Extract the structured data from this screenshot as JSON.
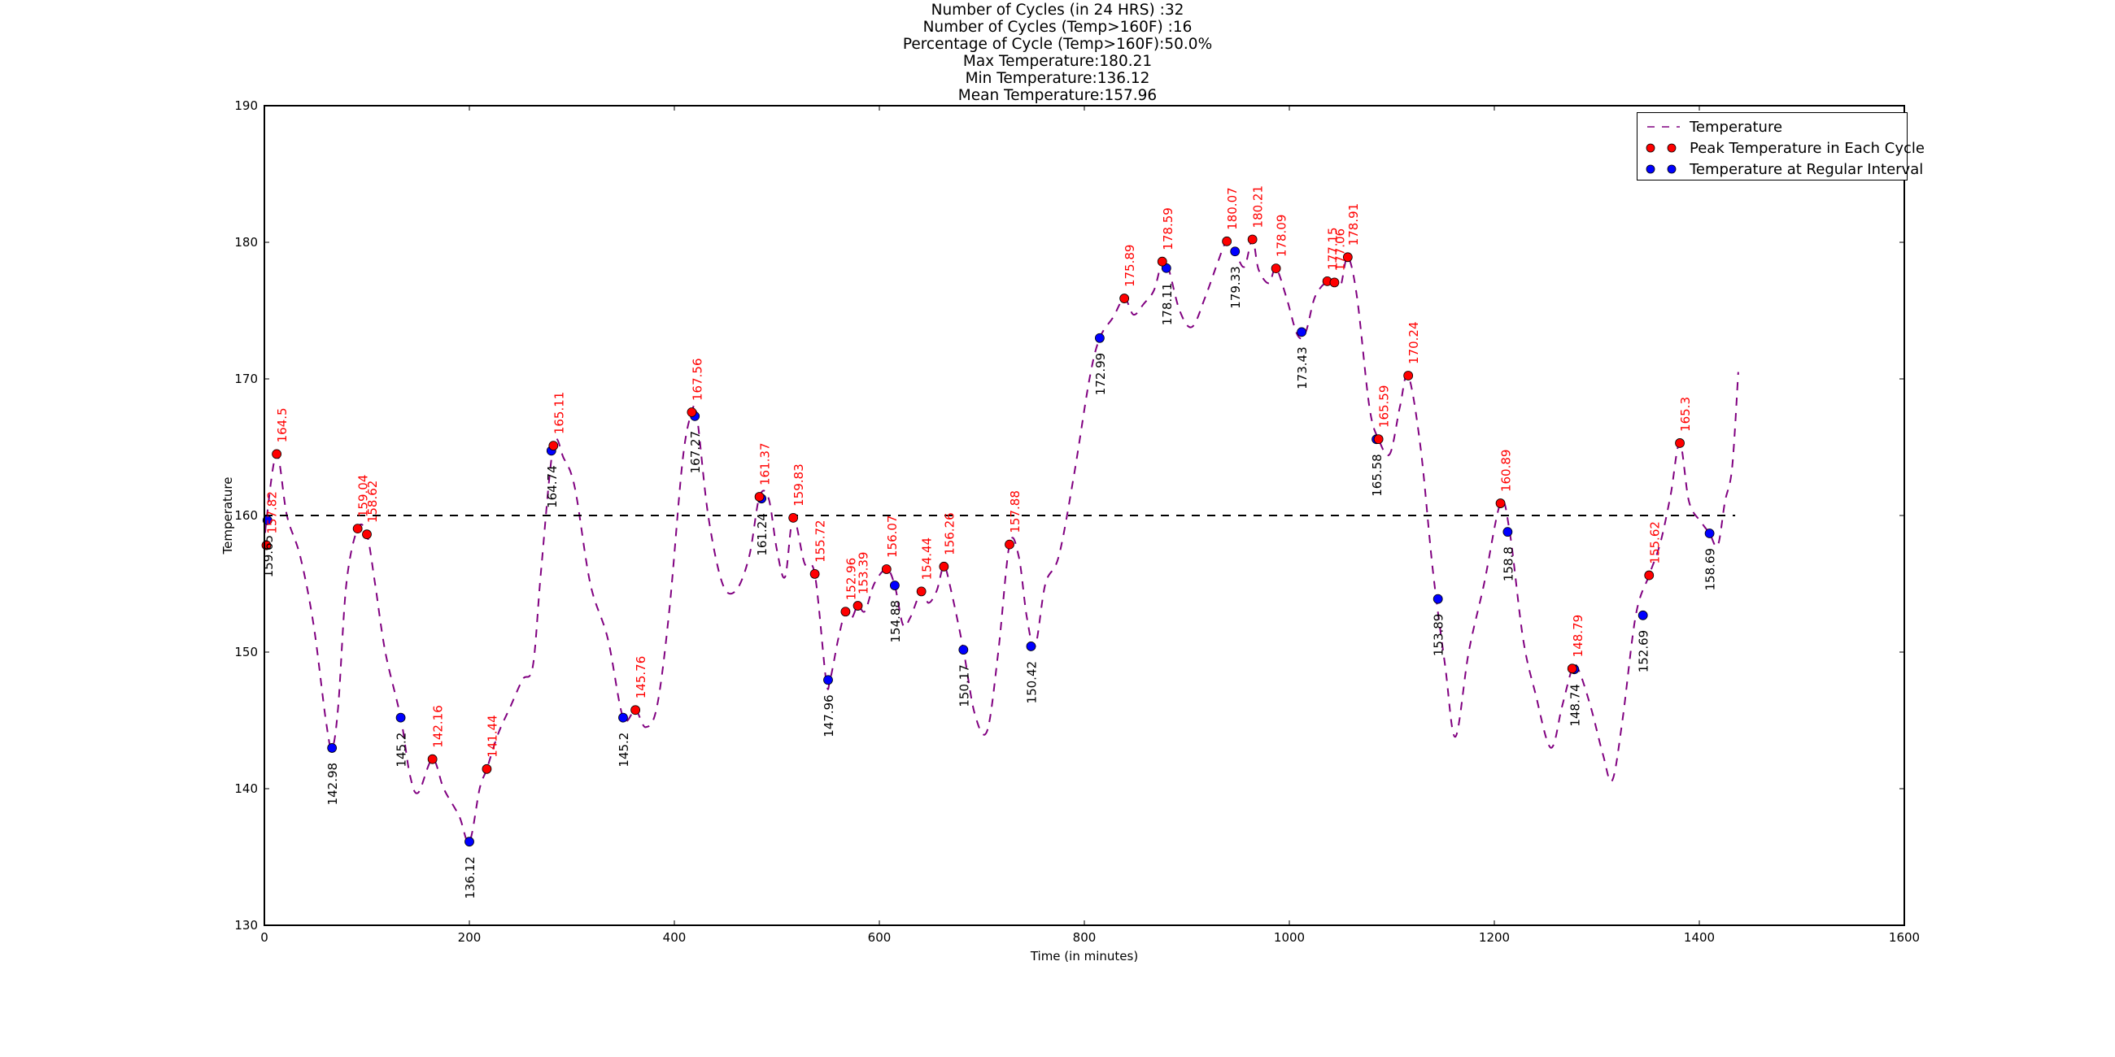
{
  "title_lines": [
    "Number of Cycles (in 24 HRS) :32",
    "Number of Cycles (Temp>160F) :16",
    "Percentage of Cycle (Temp>160F):50.0%",
    "Max Temperature:180.21",
    "Min Temperature:136.12",
    "Mean Temperature:157.96"
  ],
  "legend": {
    "placement": "top-right",
    "items": [
      {
        "label": "Temperature",
        "kind": "dashed-line",
        "color": "#800080"
      },
      {
        "label": "Peak Temperature in Each Cycle",
        "kind": "marker",
        "color": "#ff0000"
      },
      {
        "label": "Temperature at Regular Interval",
        "kind": "marker",
        "color": "#0000ff"
      }
    ]
  },
  "chart_data": {
    "type": "line",
    "title": "Number of Cycles (in 24 HRS) :32 / Number of Cycles (Temp>160F) :16 / Percentage of Cycle (Temp>160F):50.0% / Max Temperature:180.21 / Min Temperature:136.12 / Mean Temperature:157.96",
    "xlabel": "Time (in minutes)",
    "ylabel": "Temperature",
    "xlim": [
      0,
      1600
    ],
    "ylim": [
      130,
      190
    ],
    "xticks": [
      0,
      200,
      400,
      600,
      800,
      1000,
      1200,
      1400,
      1600
    ],
    "yticks": [
      130,
      140,
      150,
      160,
      170,
      180,
      190
    ],
    "grid": false,
    "legend_placement": "top-right",
    "threshold": {
      "value": 160,
      "x_range": [
        0,
        1435
      ],
      "style": "dashed",
      "color": "#000000"
    },
    "colors": {
      "line": "#800080",
      "peak": "#ff0000",
      "regular": "#0000ff",
      "peak_label": "#ff0000",
      "regular_label": "#000000"
    },
    "series": [
      {
        "name": "Temperature",
        "style": "dashed",
        "x": [
          0,
          2,
          12,
          22,
          35,
          48,
          60,
          66,
          72,
          80,
          91,
          100,
          108,
          118,
          133,
          142,
          150,
          164,
          175,
          190,
          200,
          210,
          217,
          228,
          240,
          252,
          262,
          270,
          282,
          292,
          303,
          318,
          335,
          350,
          362,
          372,
          383,
          395,
          408,
          417,
          422,
          433,
          447,
          460,
          473,
          483,
          492,
          500,
          508,
          516,
          527,
          537,
          548,
          552,
          560,
          567,
          573,
          579,
          586,
          595,
          607,
          615,
          623,
          630,
          641,
          648,
          656,
          663,
          670,
          682,
          693,
          705,
          716,
          727,
          736,
          744,
          752,
          762,
          775,
          790,
          805,
          815,
          828,
          839,
          848,
          858,
          868,
          876,
          882,
          893,
          905,
          918,
          930,
          939,
          947,
          956,
          964,
          970,
          980,
          987,
          997,
          1008,
          1016,
          1025,
          1037,
          1044,
          1050,
          1057,
          1066,
          1078,
          1087,
          1098,
          1108,
          1116,
          1128,
          1140,
          1152,
          1162,
          1175,
          1190,
          1206,
          1215,
          1228,
          1240,
          1255,
          1266,
          1276,
          1282,
          1294,
          1306,
          1315,
          1325,
          1338,
          1351,
          1362,
          1372,
          1381,
          1390,
          1402,
          1410,
          1418,
          1425,
          1432,
          1438
        ],
        "y": [
          157.6,
          159.65,
          164.5,
          160,
          157,
          152,
          145,
          142.98,
          146,
          155,
          159.04,
          158.62,
          155,
          150,
          145.2,
          141,
          139.7,
          142.16,
          140,
          138,
          136.12,
          140,
          141.44,
          144,
          146,
          148,
          149,
          156,
          165.11,
          164.2,
          162,
          155,
          151,
          145.2,
          145.76,
          144.5,
          146,
          153,
          164,
          167.56,
          167.27,
          160,
          155,
          154.5,
          157,
          161.37,
          161.24,
          157.5,
          155.5,
          159.83,
          156.5,
          155.72,
          147.96,
          148,
          151,
          152.96,
          152.5,
          153.39,
          153,
          155,
          156.07,
          154.88,
          152,
          152.5,
          154.44,
          153.6,
          154.5,
          156.26,
          154.5,
          150.17,
          145.5,
          144.2,
          150,
          157.88,
          157,
          152.5,
          150.42,
          155,
          157,
          163,
          170,
          172.99,
          174.5,
          175.89,
          174.7,
          175.5,
          176.5,
          178.59,
          178.11,
          175,
          173.8,
          176,
          178.5,
          180.07,
          179.33,
          178.2,
          180.21,
          178,
          177,
          178.09,
          176,
          173.2,
          173.43,
          176,
          177.15,
          177.06,
          176.8,
          178.91,
          176,
          168,
          165.59,
          164.5,
          168,
          170.24,
          165,
          156,
          149,
          143.8,
          150,
          155,
          160.89,
          158.8,
          151,
          147,
          143,
          146,
          148.79,
          148.74,
          146,
          142.5,
          140.6,
          145,
          152.69,
          155.62,
          158,
          161.5,
          165.3,
          161,
          159.5,
          158.69,
          157.8,
          161,
          163.5,
          170.5
        ]
      },
      {
        "name": "Peak Temperature in Each Cycle",
        "marker": "circle",
        "x": [
          2,
          12,
          91,
          100,
          164,
          217,
          282,
          362,
          417,
          483,
          516,
          537,
          567,
          579,
          607,
          641,
          663,
          727,
          839,
          876,
          939,
          964,
          987,
          1037,
          1044,
          1057,
          1087,
          1116,
          1206,
          1276,
          1351,
          1381
        ],
        "y": [
          157.82,
          164.5,
          159.04,
          158.62,
          142.16,
          141.44,
          165.11,
          145.76,
          167.56,
          161.37,
          159.83,
          155.72,
          152.96,
          153.39,
          156.07,
          154.44,
          156.26,
          157.88,
          175.89,
          178.59,
          180.07,
          180.21,
          178.09,
          177.15,
          177.06,
          178.91,
          165.59,
          170.24,
          160.89,
          148.79,
          155.62,
          165.3
        ],
        "labels": [
          "157.82",
          "164.5",
          "159.04",
          "158.62",
          "142.16",
          "141.44",
          "165.11",
          "145.76",
          "167.56",
          "161.37",
          "159.83",
          "155.72",
          "152.96",
          "153.39",
          "156.07",
          "154.44",
          "156.26",
          "157.88",
          "175.89",
          "178.59",
          "180.07",
          "180.21",
          "178.09",
          "177.15",
          "177.06",
          "178.91",
          "165.59",
          "170.24",
          "160.89",
          "148.79",
          "155.62",
          "165.3"
        ]
      },
      {
        "name": "Temperature at Regular Interval",
        "marker": "circle",
        "x": [
          3,
          66,
          133,
          200,
          280,
          350,
          420,
          485,
          550,
          615,
          682,
          748,
          815,
          880,
          947,
          1012,
          1085,
          1145,
          1213,
          1278,
          1345,
          1410
        ],
        "y": [
          159.65,
          142.98,
          145.2,
          136.12,
          164.74,
          145.2,
          167.27,
          161.24,
          147.96,
          154.88,
          150.17,
          150.42,
          172.99,
          178.11,
          179.33,
          173.43,
          165.58,
          153.89,
          158.8,
          148.74,
          152.69,
          158.69
        ],
        "labels": [
          "159.65",
          "142.98",
          "145.2",
          "136.12",
          "164.74",
          "145.2",
          "167.27",
          "161.24",
          "147.96",
          "154.88",
          "150.17",
          "150.42",
          "172.99",
          "178.11",
          "179.33",
          "173.43",
          "165.58",
          "153.89",
          "158.8",
          "148.74",
          "152.69",
          "158.69"
        ]
      }
    ]
  }
}
